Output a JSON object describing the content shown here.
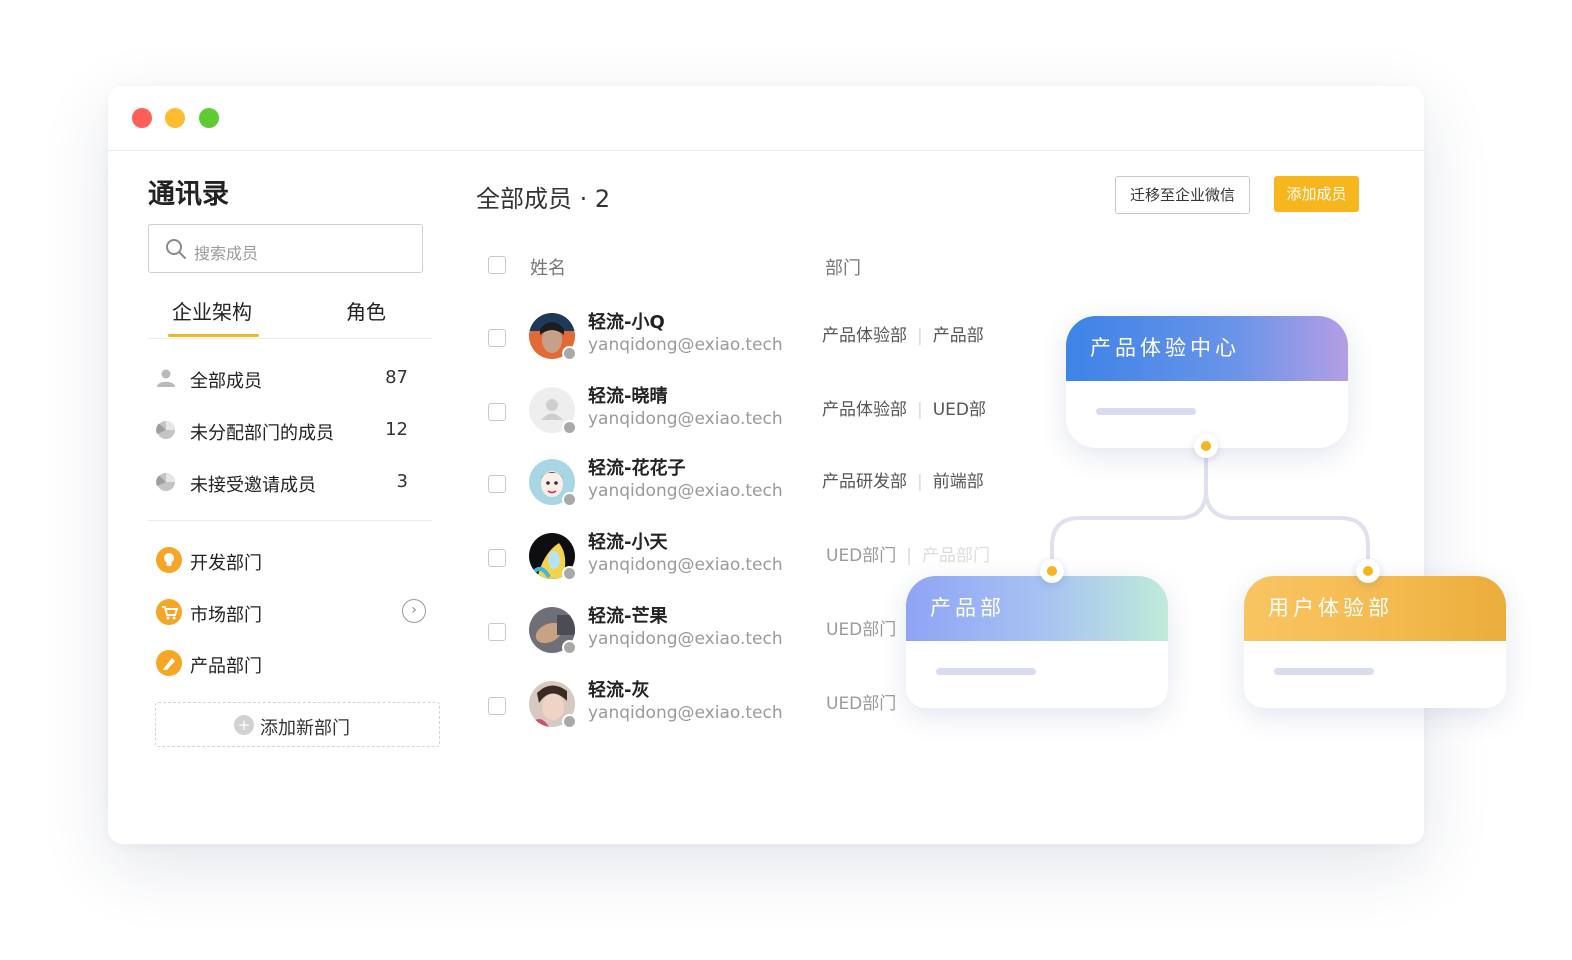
{
  "window": {
    "controls": [
      "close",
      "minimize",
      "maximize"
    ]
  },
  "sidebar": {
    "title": "通讯录",
    "search_placeholder": "搜索成员",
    "tabs": [
      {
        "label": "企业架构",
        "active": true
      },
      {
        "label": "角色",
        "active": false
      }
    ],
    "groups": [
      {
        "label": "全部成员",
        "count": "87",
        "icon": "person-icon"
      },
      {
        "label": "未分配部门的成员",
        "count": "12",
        "icon": "pie-icon"
      },
      {
        "label": "未接受邀请成员",
        "count": "3",
        "icon": "pie-icon"
      }
    ],
    "departments": [
      {
        "label": "开发部门",
        "icon": "bulb-icon"
      },
      {
        "label": "市场部门",
        "icon": "cart-icon"
      },
      {
        "label": "产品部门",
        "icon": "pen-icon"
      }
    ],
    "add_department_label": "添加新部门"
  },
  "main": {
    "title": "全部成员 · 2",
    "migrate_button": "迁移至企业微信",
    "add_button": "添加成员",
    "columns": {
      "name": "姓名",
      "department": "部门"
    },
    "members": [
      {
        "name": "轻流-小Q",
        "email": "yanqidong@exiao.tech",
        "dept1": "产品体验部",
        "dept2": "产品部"
      },
      {
        "name": "轻流-晓晴",
        "email": "yanqidong@exiao.tech",
        "dept1": "产品体验部",
        "dept2": "UED部"
      },
      {
        "name": "轻流-花花子",
        "email": "yanqidong@exiao.tech",
        "dept1": "产品研发部",
        "dept2": "前端部"
      },
      {
        "name": "轻流-小天",
        "email": "yanqidong@exiao.tech",
        "dept1": "UED部门",
        "dept2": "产品部门"
      },
      {
        "name": "轻流-芒果",
        "email": "yanqidong@exiao.tech",
        "dept1": "UED部门",
        "dept2": ""
      },
      {
        "name": "轻流-灰",
        "email": "yanqidong@exiao.tech",
        "dept1": "UED部门",
        "dept2": ""
      }
    ]
  },
  "org_chart": {
    "root": "产品体验中心",
    "children": [
      "产品部",
      "用户体验部"
    ]
  },
  "colors": {
    "accent": "#f5b61b",
    "close": "#fe5f57",
    "minimize": "#febc2e",
    "maximize": "#5ecb32"
  }
}
